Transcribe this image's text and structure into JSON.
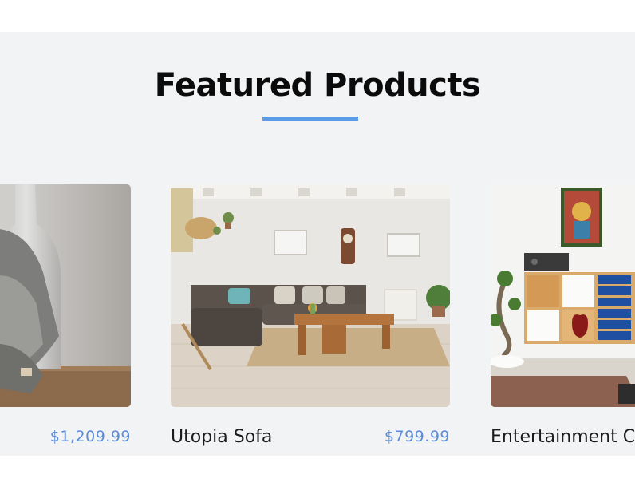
{
  "section": {
    "title": "Featured Products",
    "accent_color": "#5b9be8"
  },
  "products": [
    {
      "name": "",
      "price": "$1,209.99",
      "image": "vase-and-knit-scarf-photo"
    },
    {
      "name": "Utopia Sofa",
      "price": "$799.99",
      "image": "living-room-sofa-photo"
    },
    {
      "name": "Entertainment Ce",
      "price": "",
      "image": "entertainment-center-photo"
    }
  ]
}
